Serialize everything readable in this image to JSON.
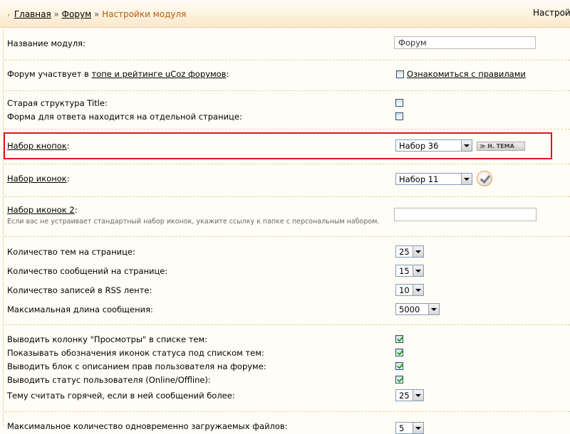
{
  "breadcrumb": {
    "home": "Главная",
    "separator": "»",
    "forum": "Форум",
    "current": "Настройки модуля"
  },
  "header_right": "Настройки",
  "module_name": {
    "label": "Название модуля:",
    "value": "Форум"
  },
  "rating": {
    "label_prefix": "Форум участвует в ",
    "label_link": "топе и рейтинге uCoz форумов",
    "label_suffix": ":",
    "checkbox_link": "Ознакомиться с правилами",
    "checked": false
  },
  "old_title": {
    "label": "Старая структура Title:",
    "checked": false
  },
  "reply_form": {
    "label": "Форма для ответа находится на отдельной странице:",
    "checked": false
  },
  "button_set": {
    "label": "Набор кнопок",
    "colon": ":",
    "value": "Набор 36",
    "preview_text": "≫ Н. ТЕМА"
  },
  "icon_set": {
    "label": "Набор иконок",
    "colon": ":",
    "value": "Набор 11",
    "preview_icon": "checkmark-icon"
  },
  "icon_set2": {
    "label": "Набор иконок 2",
    "colon": ":",
    "hint": "Если вас не устраивает стандартный набор иконок, укажите ссылку к папке с персональным набором.",
    "value": ""
  },
  "counts": [
    {
      "label": "Количество тем на странице:",
      "value": "25"
    },
    {
      "label": "Количество сообщений на странице:",
      "value": "15"
    },
    {
      "label": "Количество записей в RSS ленте:",
      "value": "10"
    },
    {
      "label": "Максимальная длина сообщения:",
      "value": "5000"
    }
  ],
  "options": [
    {
      "label": "Выводить колонку \"Просмотры\" в списке тем:",
      "checked": true
    },
    {
      "label": "Показывать обозначения иконок статуса под списком тем:",
      "checked": true
    },
    {
      "label": "Выводить блок с описанием прав пользователя на форуме:",
      "checked": true
    },
    {
      "label": "Выводить статус пользователя (Online/Offline):",
      "checked": true
    }
  ],
  "hot_topic": {
    "label": "Тему считать горячей, если в ней сообщений более:",
    "value": "25"
  },
  "max_files": {
    "label": "Максимальное количество одновременно загружаемых файлов:",
    "value": "5"
  },
  "colors": {
    "highlight": "#E0141E",
    "breadcrumb_current": "#B15E10",
    "check": "#21A121"
  }
}
